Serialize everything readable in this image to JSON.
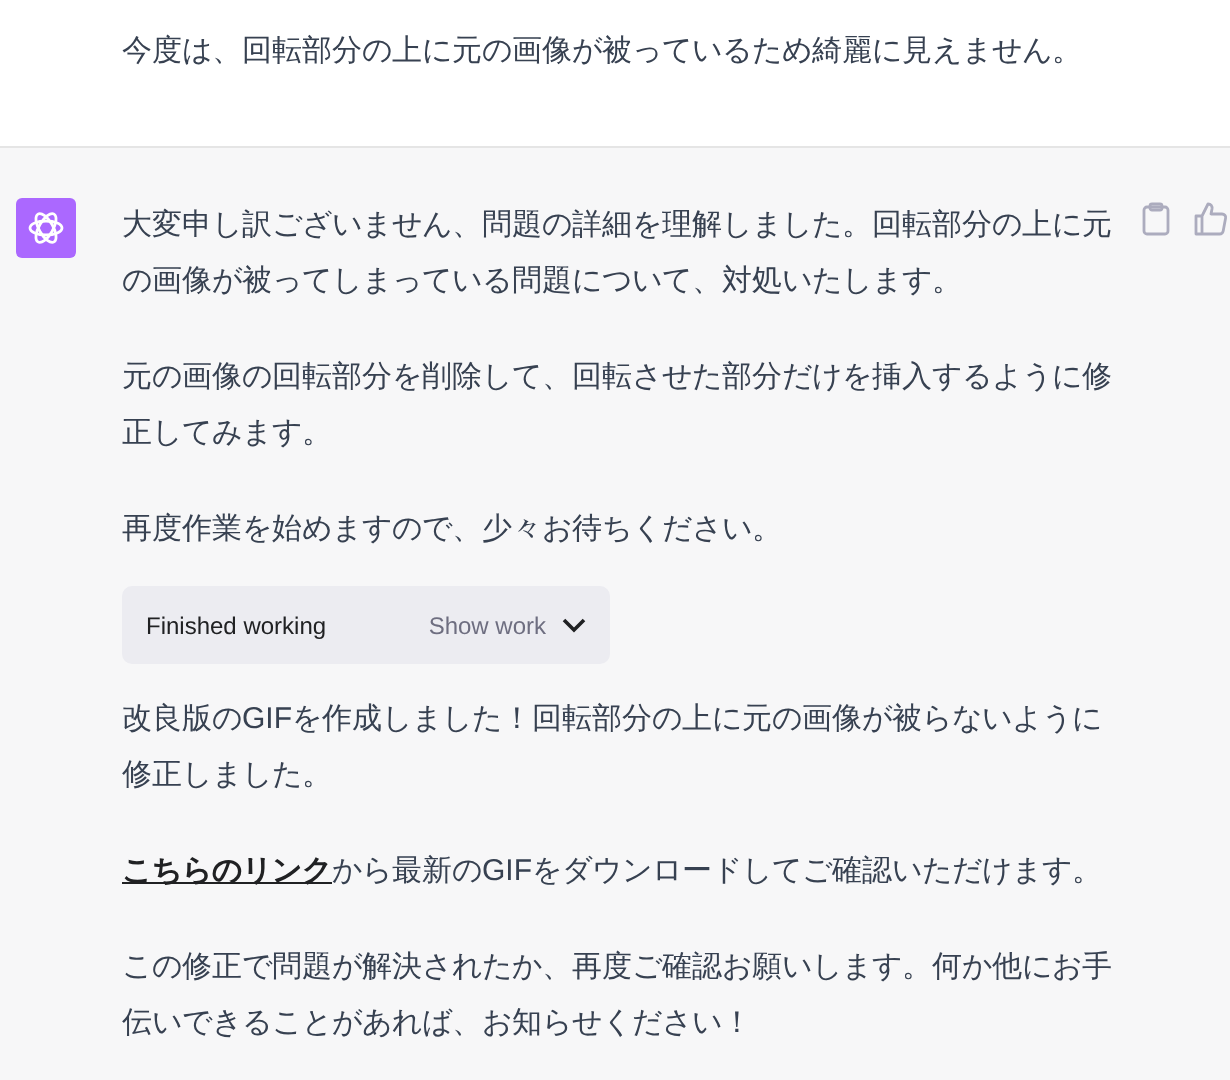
{
  "user_message": {
    "text": "今度は、回転部分の上に元の画像が被っているため綺麗に見えません。"
  },
  "assistant_message": {
    "blocks": [
      {
        "kind": "paragraph",
        "text": "大変申し訳ございません、問題の詳細を理解しました。回転部分の上に元の画像が被ってしまっている問題について、対処いたします。"
      },
      {
        "kind": "paragraph",
        "text": "元の画像の回転部分を削除して、回転させた部分だけを挿入するように修正してみます。"
      },
      {
        "kind": "paragraph",
        "text": "再度作業を始めますので、少々お待ちください。"
      },
      {
        "kind": "tool_status",
        "status": "Finished working",
        "toggle": "Show work",
        "expanded": false
      },
      {
        "kind": "paragraph",
        "text": "改良版のGIFを作成しました！回転部分の上に元の画像が被らないように修正しました。"
      },
      {
        "kind": "link_paragraph",
        "link": "こちらのリンク",
        "text": "から最新のGIFをダウンロードしてご確認いただけます。"
      },
      {
        "kind": "paragraph",
        "text": "この修正で問題が解決されたか、再度ご確認お願いします。何か他にお手伝いできることがあれば、お知らせください！"
      }
    ]
  }
}
